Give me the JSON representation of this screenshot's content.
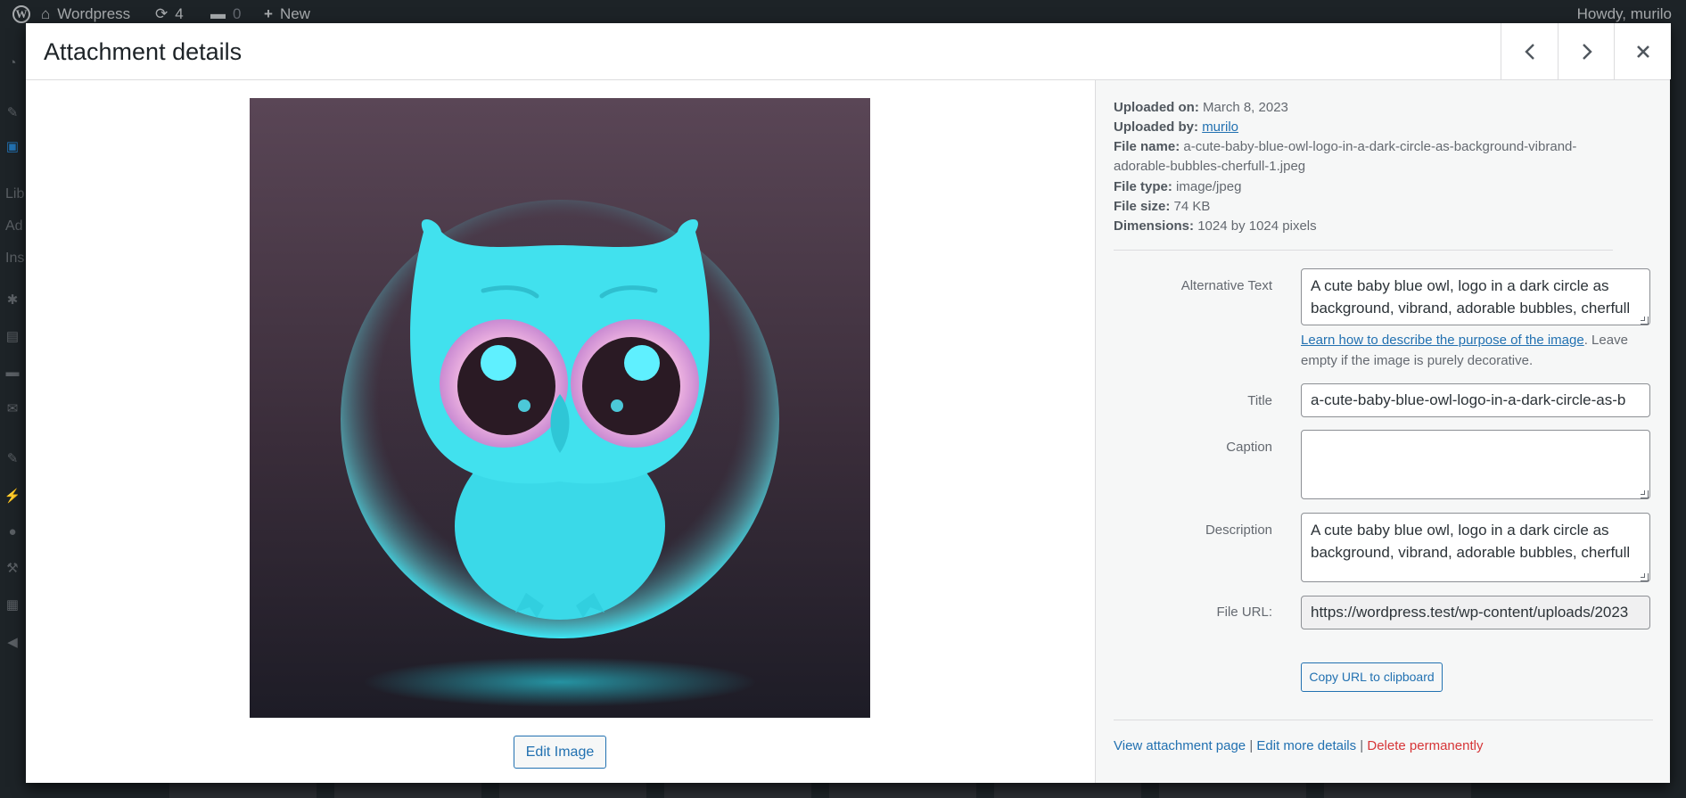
{
  "admin_bar": {
    "site_name": "Wordpress",
    "updates_count": "4",
    "comments_count": "0",
    "new_label": "New",
    "howdy": "Howdy, murilo"
  },
  "sidebar_fragments": [
    "Lib",
    "Ad",
    "Ins"
  ],
  "modal": {
    "title": "Attachment details",
    "edit_image_label": "Edit Image"
  },
  "details": {
    "uploaded_on_label": "Uploaded on:",
    "uploaded_on": "March 8, 2023",
    "uploaded_by_label": "Uploaded by:",
    "uploaded_by": "murilo",
    "file_name_label": "File name:",
    "file_name_line1": "a-cute-baby-blue-owl-logo-in-a-dark-circle-as-background-vibrand-",
    "file_name_line2": "adorable-bubbles-cherfull-1.jpeg",
    "file_type_label": "File type:",
    "file_type": "image/jpeg",
    "file_size_label": "File size:",
    "file_size": "74 KB",
    "dimensions_label": "Dimensions:",
    "dimensions": "1024 by 1024 pixels"
  },
  "fields": {
    "alt_label": "Alternative Text",
    "alt_value": "A cute baby blue owl, logo in a dark circle as background, vibrand, adorable bubbles, cherfull",
    "alt_help_link": "Learn how to describe the purpose of the image",
    "alt_help_rest": ". Leave empty if the image is purely decorative.",
    "title_label": "Title",
    "title_value": "a-cute-baby-blue-owl-logo-in-a-dark-circle-as-b",
    "caption_label": "Caption",
    "caption_value": "",
    "description_label": "Description",
    "description_value": "A cute baby blue owl, logo in a dark circle as background, vibrand, adorable bubbles, cherfull",
    "file_url_label": "File URL:",
    "file_url_value": "https://wordpress.test/wp-content/uploads/2023",
    "copy_url_label": "Copy URL to clipboard"
  },
  "actions": {
    "view_attachment": "View attachment page",
    "edit_more": "Edit more details",
    "delete": "Delete permanently",
    "separator": "|"
  },
  "icons": {
    "prev": "chevron-left-icon",
    "next": "chevron-right-icon",
    "close": "close-icon"
  }
}
